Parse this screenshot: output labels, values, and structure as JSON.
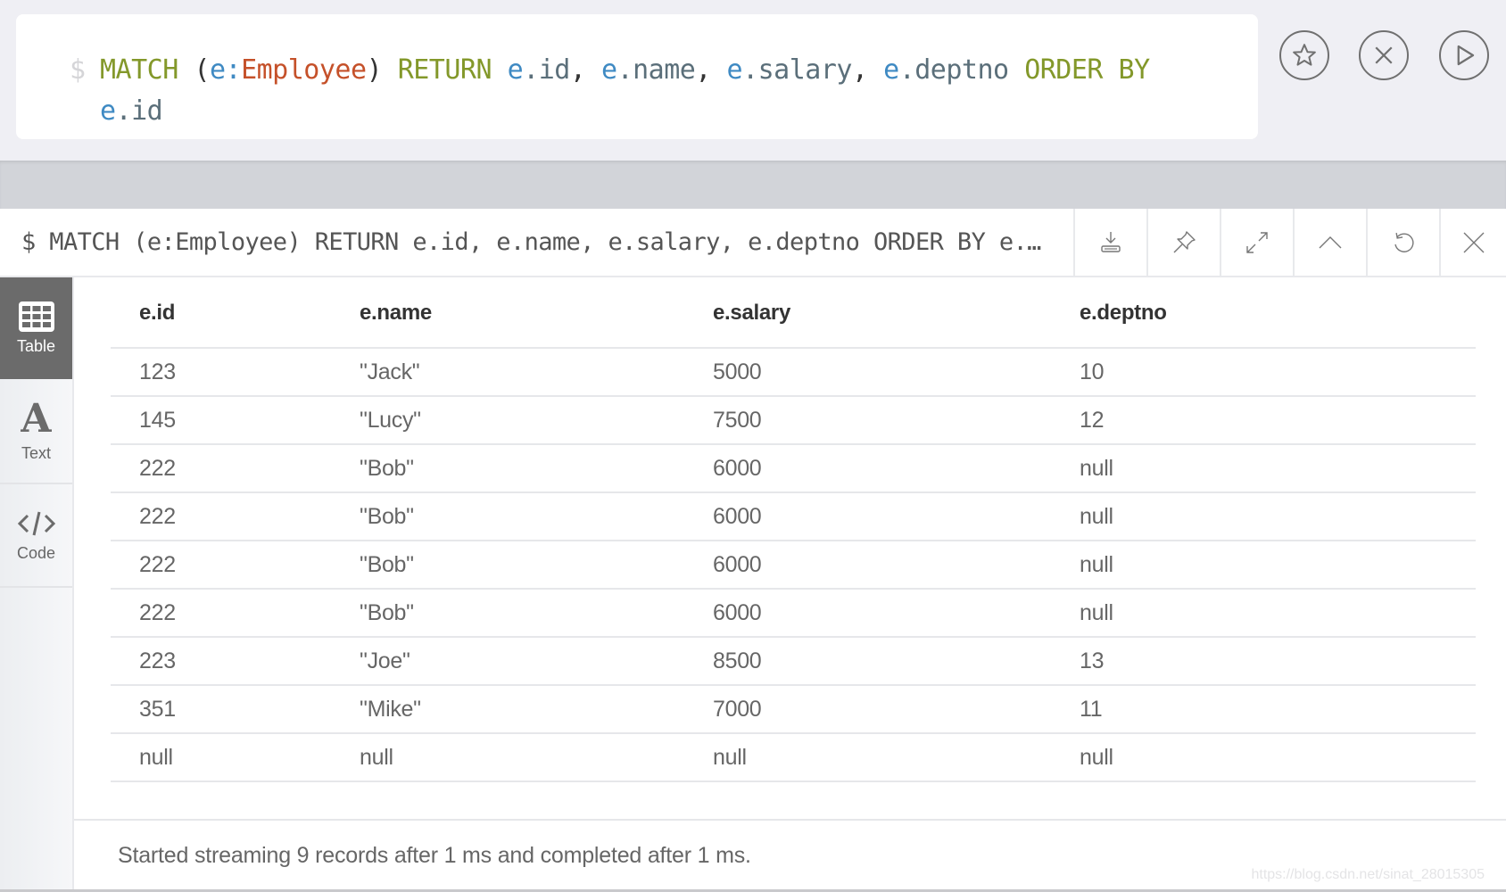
{
  "editor": {
    "prompt": "$",
    "tokens": {
      "match": "MATCH",
      "open_paren": "(",
      "var_e": "e",
      "colon": ":",
      "label": "Employee",
      "close_paren": ")",
      "return_kw": "RETURN",
      "prop_id": ".id",
      "comma": ",",
      "prop_name": ".name",
      "prop_salary": ".salary",
      "prop_deptno": ".deptno",
      "order_by": "ORDER BY"
    },
    "actions": {
      "favorite": "star-icon",
      "clear": "close-icon",
      "run": "play-icon"
    }
  },
  "frame": {
    "title": "$ MATCH (e:Employee) RETURN e.id, e.name, e.salary, e.deptno ORDER BY e.…",
    "header_buttons": [
      "download-icon",
      "pin-icon",
      "expand-icon",
      "collapse-icon",
      "rerun-icon",
      "close-icon"
    ],
    "sidebar": [
      {
        "label": "Table",
        "icon": "table-icon",
        "active": true
      },
      {
        "label": "Text",
        "icon": "text-icon",
        "active": false
      },
      {
        "label": "Code",
        "icon": "code-icon",
        "active": false
      }
    ],
    "table": {
      "columns": [
        "e.id",
        "e.name",
        "e.salary",
        "e.deptno"
      ],
      "rows": [
        [
          "123",
          "\"Jack\"",
          "5000",
          "10"
        ],
        [
          "145",
          "\"Lucy\"",
          "7500",
          "12"
        ],
        [
          "222",
          "\"Bob\"",
          "6000",
          "null"
        ],
        [
          "222",
          "\"Bob\"",
          "6000",
          "null"
        ],
        [
          "222",
          "\"Bob\"",
          "6000",
          "null"
        ],
        [
          "222",
          "\"Bob\"",
          "6000",
          "null"
        ],
        [
          "223",
          "\"Joe\"",
          "8500",
          "13"
        ],
        [
          "351",
          "\"Mike\"",
          "7000",
          "11"
        ],
        [
          "null",
          "null",
          "null",
          "null"
        ]
      ]
    },
    "footer": "Started streaming 9 records after 1 ms and completed after 1 ms."
  },
  "watermark": "https://blog.csdn.net/sinat_28015305",
  "colors": {
    "keyword": "#83982a",
    "variable": "#3f8ac3",
    "label": "#c5512a",
    "property": "#5b6f7a",
    "active_tab": "#6b6b6b"
  }
}
